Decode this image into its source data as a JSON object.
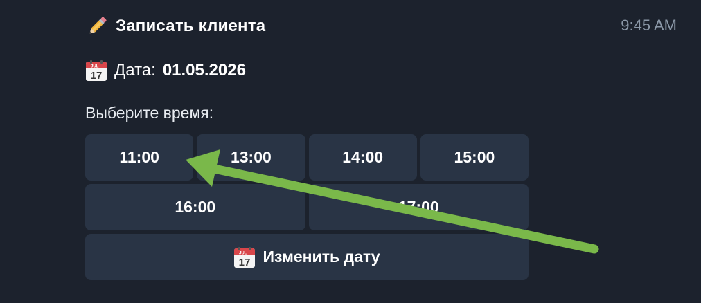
{
  "header": {
    "title": "Записать клиента",
    "title_icon": "pencil-icon",
    "time": "9:45 AM"
  },
  "date": {
    "label": "Дата:",
    "value": "01.05.2026",
    "icon": "calendar-icon",
    "icon_month": "JUL",
    "icon_day": "17"
  },
  "prompt": "Выберите время:",
  "keyboard": {
    "row1": [
      "11:00",
      "13:00",
      "14:00",
      "15:00"
    ],
    "row2": [
      "16:00",
      "17:00"
    ],
    "change_date": "Изменить дату"
  },
  "colors": {
    "background": "#1c222d",
    "button": "#293445",
    "arrow": "#7ab84a",
    "time": "#8b98a8"
  }
}
